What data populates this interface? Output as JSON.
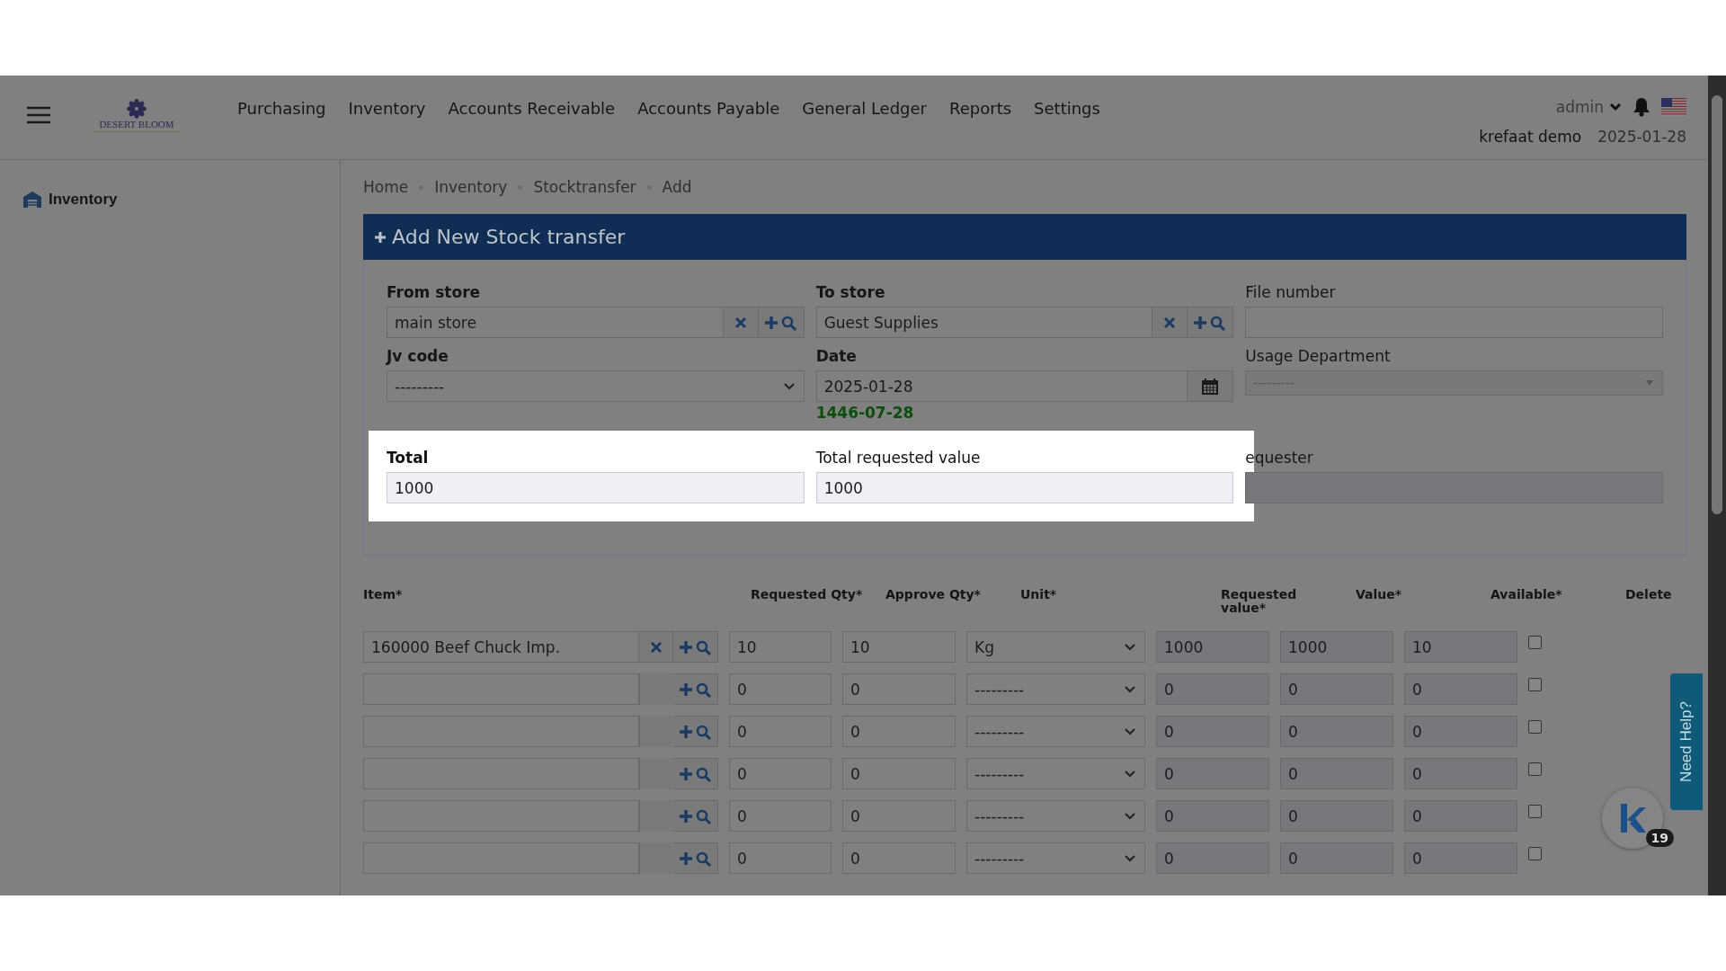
{
  "header": {
    "logo_text": "DESERT BLOOM",
    "nav": [
      {
        "label": "Purchasing"
      },
      {
        "label": "Inventory"
      },
      {
        "label": "Accounts Receivable"
      },
      {
        "label": "Accounts Payable"
      },
      {
        "label": "General Ledger"
      },
      {
        "label": "Reports"
      },
      {
        "label": "Settings"
      }
    ],
    "user": "admin",
    "company": "krefaat demo",
    "date": "2025-01-28"
  },
  "sidebar": {
    "items": [
      {
        "label": "Inventory",
        "selected": true
      }
    ]
  },
  "breadcrumb": [
    "Home",
    "Inventory",
    "Stocktransfer",
    "Add"
  ],
  "panel": {
    "title": "Add New Stock transfer"
  },
  "form": {
    "fields": [
      {
        "kind": "lookup",
        "label": "From store",
        "required": true,
        "value": "main store",
        "highlighted": false
      },
      {
        "kind": "lookup",
        "label": "To store",
        "required": true,
        "value": "Guest Supplies",
        "highlighted": false
      },
      {
        "kind": "text",
        "label": "File number",
        "required": false,
        "highlighted": false
      },
      {
        "kind": "select",
        "label": "Jv code",
        "required": true,
        "value": "---------",
        "highlighted": false
      },
      {
        "kind": "date",
        "label": "Date",
        "required": true,
        "value": "2025-01-28",
        "hijri": "1446-07-28",
        "highlighted": false
      },
      {
        "kind": "combo",
        "label": "Usage Department",
        "required": false,
        "value": "---------",
        "highlighted": false
      },
      {
        "kind": "readonly",
        "label": "Total",
        "required": true,
        "value": "1000",
        "highlighted": true
      },
      {
        "kind": "readonly",
        "label": "Total requested value",
        "required": false,
        "value": "1000",
        "highlighted": true
      },
      {
        "kind": "readonly",
        "label": "equester",
        "required": false,
        "highlighted": false
      }
    ]
  },
  "table": {
    "columns": [
      "Item*",
      "Requested Qty*",
      "Approve Qty*",
      "Unit*",
      "Requested value*",
      "Value*",
      "Available*",
      "Delete"
    ],
    "rows": [
      {
        "item": "160000 Beef Chuck Imp.",
        "requested_qty": "10",
        "approve_qty": "10",
        "unit": "Kg",
        "requested_value": "1000",
        "value": "1000",
        "available": "10",
        "delete": false
      },
      {
        "requested_qty": "0",
        "approve_qty": "0",
        "unit": "---------",
        "requested_value": "0",
        "value": "0",
        "available": "0",
        "delete": false
      },
      {
        "requested_qty": "0",
        "approve_qty": "0",
        "unit": "---------",
        "requested_value": "0",
        "value": "0",
        "available": "0",
        "delete": false
      },
      {
        "requested_qty": "0",
        "approve_qty": "0",
        "unit": "---------",
        "requested_value": "0",
        "value": "0",
        "available": "0",
        "delete": false
      },
      {
        "requested_qty": "0",
        "approve_qty": "0",
        "unit": "---------",
        "requested_value": "0",
        "value": "0",
        "available": "0",
        "delete": false
      },
      {
        "requested_qty": "0",
        "approve_qty": "0",
        "unit": "---------",
        "requested_value": "0",
        "value": "0",
        "available": "0",
        "delete": false
      }
    ]
  },
  "help": {
    "label": "Need Help?",
    "badge": "19"
  }
}
